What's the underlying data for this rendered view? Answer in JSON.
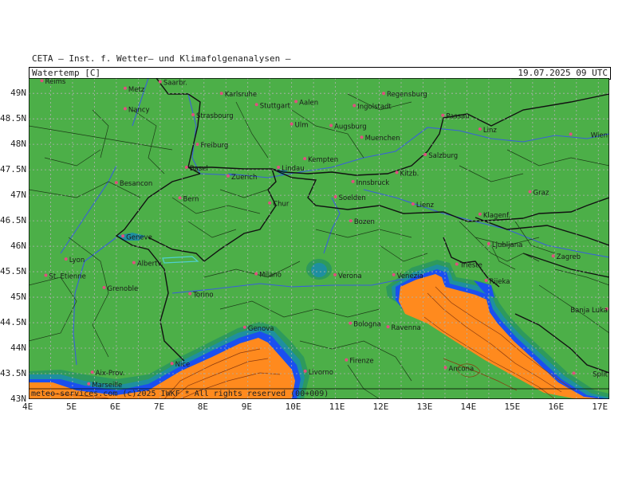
{
  "header": {
    "organization": "CETA – Inst. f. Wetter– und Klimafolgenanalysen –",
    "product": "Watertemp [C]",
    "datetime": "19.07.2025  09 UTC"
  },
  "footer": {
    "credit": "meteo-services.com (c)2025 IWKF * All rights reserved (00+009)"
  },
  "axes": {
    "lat_labels": [
      "49N",
      "48.5N",
      "48N",
      "47.5N",
      "47N",
      "46.5N",
      "46N",
      "45.5N",
      "45N",
      "44.5N",
      "44N",
      "43.5N",
      "43N"
    ],
    "lon_labels": [
      "4E",
      "5E",
      "6E",
      "7E",
      "8E",
      "9E",
      "10E",
      "11E",
      "12E",
      "13E",
      "14E",
      "15E",
      "16E",
      "17E"
    ]
  },
  "cities": [
    {
      "name": "Reims",
      "lon": 4.3,
      "lat": 49.25
    },
    {
      "name": "Metz",
      "lon": 6.2,
      "lat": 49.1
    },
    {
      "name": "Saarbr.",
      "lon": 7.0,
      "lat": 49.23
    },
    {
      "name": "Karlsruhe",
      "lon": 8.4,
      "lat": 49.0
    },
    {
      "name": "Nancy",
      "lon": 6.2,
      "lat": 48.7
    },
    {
      "name": "Stuttgart",
      "lon": 9.2,
      "lat": 48.78
    },
    {
      "name": "Aalen",
      "lon": 10.1,
      "lat": 48.84
    },
    {
      "name": "Ingolstadt",
      "lon": 11.43,
      "lat": 48.76
    },
    {
      "name": "Regensburg",
      "lon": 12.1,
      "lat": 49.0
    },
    {
      "name": "Strasbourg",
      "lon": 7.75,
      "lat": 48.58
    },
    {
      "name": "Ulm",
      "lon": 10.0,
      "lat": 48.4
    },
    {
      "name": "Augsburg",
      "lon": 10.9,
      "lat": 48.37
    },
    {
      "name": "Passau",
      "lon": 13.45,
      "lat": 48.57
    },
    {
      "name": "Linz",
      "lon": 14.3,
      "lat": 48.3
    },
    {
      "name": "Freiburg",
      "lon": 7.85,
      "lat": 48.0
    },
    {
      "name": "Muenchen",
      "lon": 11.6,
      "lat": 48.14
    },
    {
      "name": "Wien",
      "lon": 16.37,
      "lat": 48.2
    },
    {
      "name": "Kempten",
      "lon": 10.3,
      "lat": 47.72
    },
    {
      "name": "Salzburg",
      "lon": 13.05,
      "lat": 47.8
    },
    {
      "name": "Basel",
      "lon": 7.6,
      "lat": 47.55
    },
    {
      "name": "Zuerich",
      "lon": 8.55,
      "lat": 47.38
    },
    {
      "name": "Lindau",
      "lon": 9.7,
      "lat": 47.55
    },
    {
      "name": "Kitzb.",
      "lon": 12.4,
      "lat": 47.45
    },
    {
      "name": "Besancon",
      "lon": 6.0,
      "lat": 47.25
    },
    {
      "name": "Innsbruck",
      "lon": 11.4,
      "lat": 47.27
    },
    {
      "name": "Graz",
      "lon": 15.44,
      "lat": 47.07
    },
    {
      "name": "Bern",
      "lon": 7.45,
      "lat": 46.95
    },
    {
      "name": "Chur",
      "lon": 9.5,
      "lat": 46.85
    },
    {
      "name": "Soelden",
      "lon": 11.0,
      "lat": 46.97
    },
    {
      "name": "Lienz",
      "lon": 12.77,
      "lat": 46.83
    },
    {
      "name": "Klagenf.",
      "lon": 14.3,
      "lat": 46.63
    },
    {
      "name": "Bozen",
      "lon": 11.35,
      "lat": 46.5
    },
    {
      "name": "Geneve",
      "lon": 6.15,
      "lat": 46.2
    },
    {
      "name": "Ljubljana",
      "lon": 14.5,
      "lat": 46.05
    },
    {
      "name": "Albertv.",
      "lon": 6.4,
      "lat": 45.68
    },
    {
      "name": "Lyon",
      "lon": 4.85,
      "lat": 45.75
    },
    {
      "name": "Zagreb",
      "lon": 15.97,
      "lat": 45.81
    },
    {
      "name": "Trieste",
      "lon": 13.77,
      "lat": 45.65
    },
    {
      "name": "Venezia",
      "lon": 12.33,
      "lat": 45.44
    },
    {
      "name": "Milano",
      "lon": 9.19,
      "lat": 45.46
    },
    {
      "name": "Verona",
      "lon": 10.99,
      "lat": 45.44
    },
    {
      "name": "St. Etienne",
      "lon": 4.39,
      "lat": 45.43
    },
    {
      "name": "Rijeka",
      "lon": 14.44,
      "lat": 45.33
    },
    {
      "name": "Grenoble",
      "lon": 5.72,
      "lat": 45.19
    },
    {
      "name": "Torino",
      "lon": 7.68,
      "lat": 45.07
    },
    {
      "name": "Banja Luka",
      "lon": 17.19,
      "lat": 44.77
    },
    {
      "name": "Genova",
      "lon": 8.93,
      "lat": 44.41
    },
    {
      "name": "Bologna",
      "lon": 11.34,
      "lat": 44.49
    },
    {
      "name": "Ravenna",
      "lon": 12.2,
      "lat": 44.42
    },
    {
      "name": "Nice",
      "lon": 7.27,
      "lat": 43.7
    },
    {
      "name": "Firenze",
      "lon": 11.25,
      "lat": 43.77
    },
    {
      "name": "Ancona",
      "lon": 13.51,
      "lat": 43.62
    },
    {
      "name": "Split",
      "lon": 16.44,
      "lat": 43.51
    },
    {
      "name": "Aix-Prov.",
      "lon": 5.45,
      "lat": 43.53
    },
    {
      "name": "Livorno",
      "lon": 10.31,
      "lat": 43.55
    },
    {
      "name": "Marseille",
      "lon": 5.37,
      "lat": 43.3
    }
  ],
  "colors": {
    "land": "#4caf48",
    "coast_1": "#2e9a5c",
    "coast_2": "#1e8fa0",
    "sea_cold": "#1a4ff0",
    "sea_warm": "#ff8a1e",
    "grid": "#b0b0b0",
    "city": "#e05080",
    "river": "#3a5fdc"
  }
}
